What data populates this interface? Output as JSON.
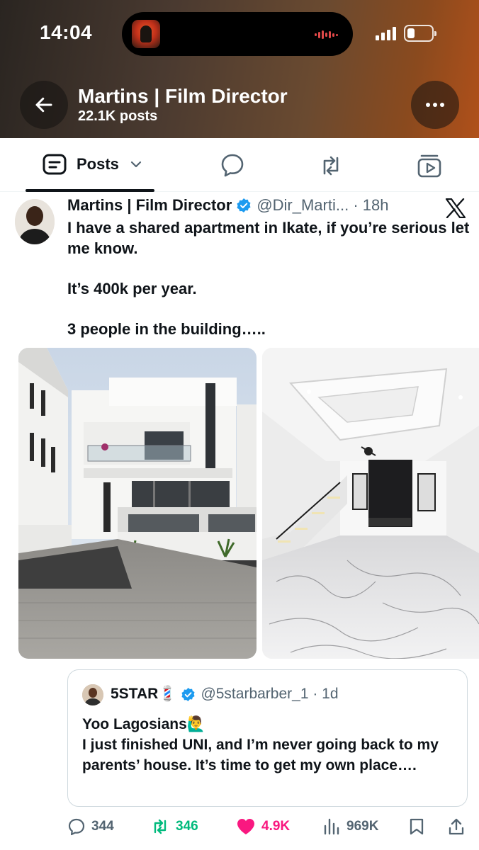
{
  "status_bar": {
    "time": "14:04"
  },
  "header": {
    "title": "Martins | Film Director",
    "subtitle": "22.1K posts"
  },
  "tabs": {
    "posts_label": "Posts"
  },
  "tweet": {
    "author_name": "Martins | Film Director",
    "handle_time": "@Dir_Marti... · 18h",
    "lines": [
      "I have a shared apartment in Ikate, if you’re serious let me know.",
      "It’s 400k per year.",
      "3 people in the building….."
    ]
  },
  "quote": {
    "author_name": "5STAR💈",
    "handle_time": "@5starbarber_1 · 1d",
    "lines": [
      "Yoo Lagosians🙋‍♂️",
      "I just finished UNI, and I’m never going back to my parents’ house. It’s time to get my own place…."
    ]
  },
  "actions": {
    "replies": "344",
    "reposts": "346",
    "likes": "4.9K",
    "views": "969K"
  },
  "colors": {
    "text": "#0f1419",
    "secondary": "#536471",
    "verified": "#1d9bf0",
    "repost": "#00ba7c",
    "like": "#f91880"
  },
  "icons": [
    "back-arrow-icon",
    "more-icon",
    "posts-icon",
    "chevron-down-icon",
    "reply-tab-icon",
    "repost-tab-icon",
    "video-tab-icon",
    "verified-icon",
    "x-logo-icon",
    "reply-icon",
    "repost-icon",
    "heart-icon",
    "views-icon",
    "bookmark-icon",
    "share-icon"
  ]
}
